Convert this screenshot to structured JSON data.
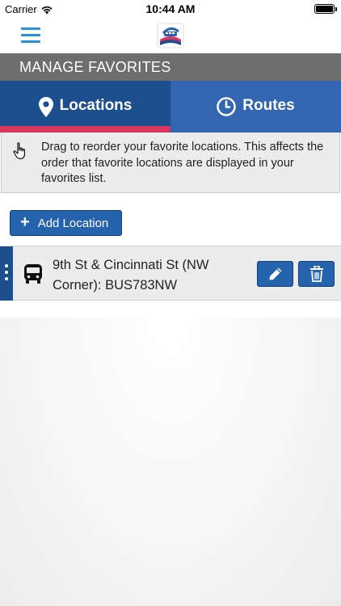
{
  "status_bar": {
    "carrier": "Carrier",
    "time": "10:44 AM",
    "icons": [
      "wifi-icon",
      "battery-icon"
    ]
  },
  "nav": {
    "menu_icon": "hamburger-menu-icon",
    "logo_alt": "CityBus"
  },
  "header": {
    "title": "MANAGE FAVORITES"
  },
  "tabs": [
    {
      "label": "Locations",
      "icon": "map-pin-icon",
      "active": true
    },
    {
      "label": "Routes",
      "icon": "clock-icon",
      "active": false
    }
  ],
  "info": {
    "icon": "pointing-hand-icon",
    "text": "Drag to reorder your favorite locations. This affects the order that favorite locations are displayed in your favorites list."
  },
  "add_button": {
    "icon": "plus-icon",
    "label": "Add Location"
  },
  "favorites": [
    {
      "icon": "bus-icon",
      "name": "9th St & Cincinnati St (NW Corner): BUS783NW"
    }
  ],
  "colors": {
    "primary_dark": "#1d4f8e",
    "primary": "#2563ad",
    "tab_inactive": "#3266b0",
    "accent": "#d8365f",
    "header_gray": "#6e6e6e",
    "menu_blue": "#2a8fd9"
  }
}
